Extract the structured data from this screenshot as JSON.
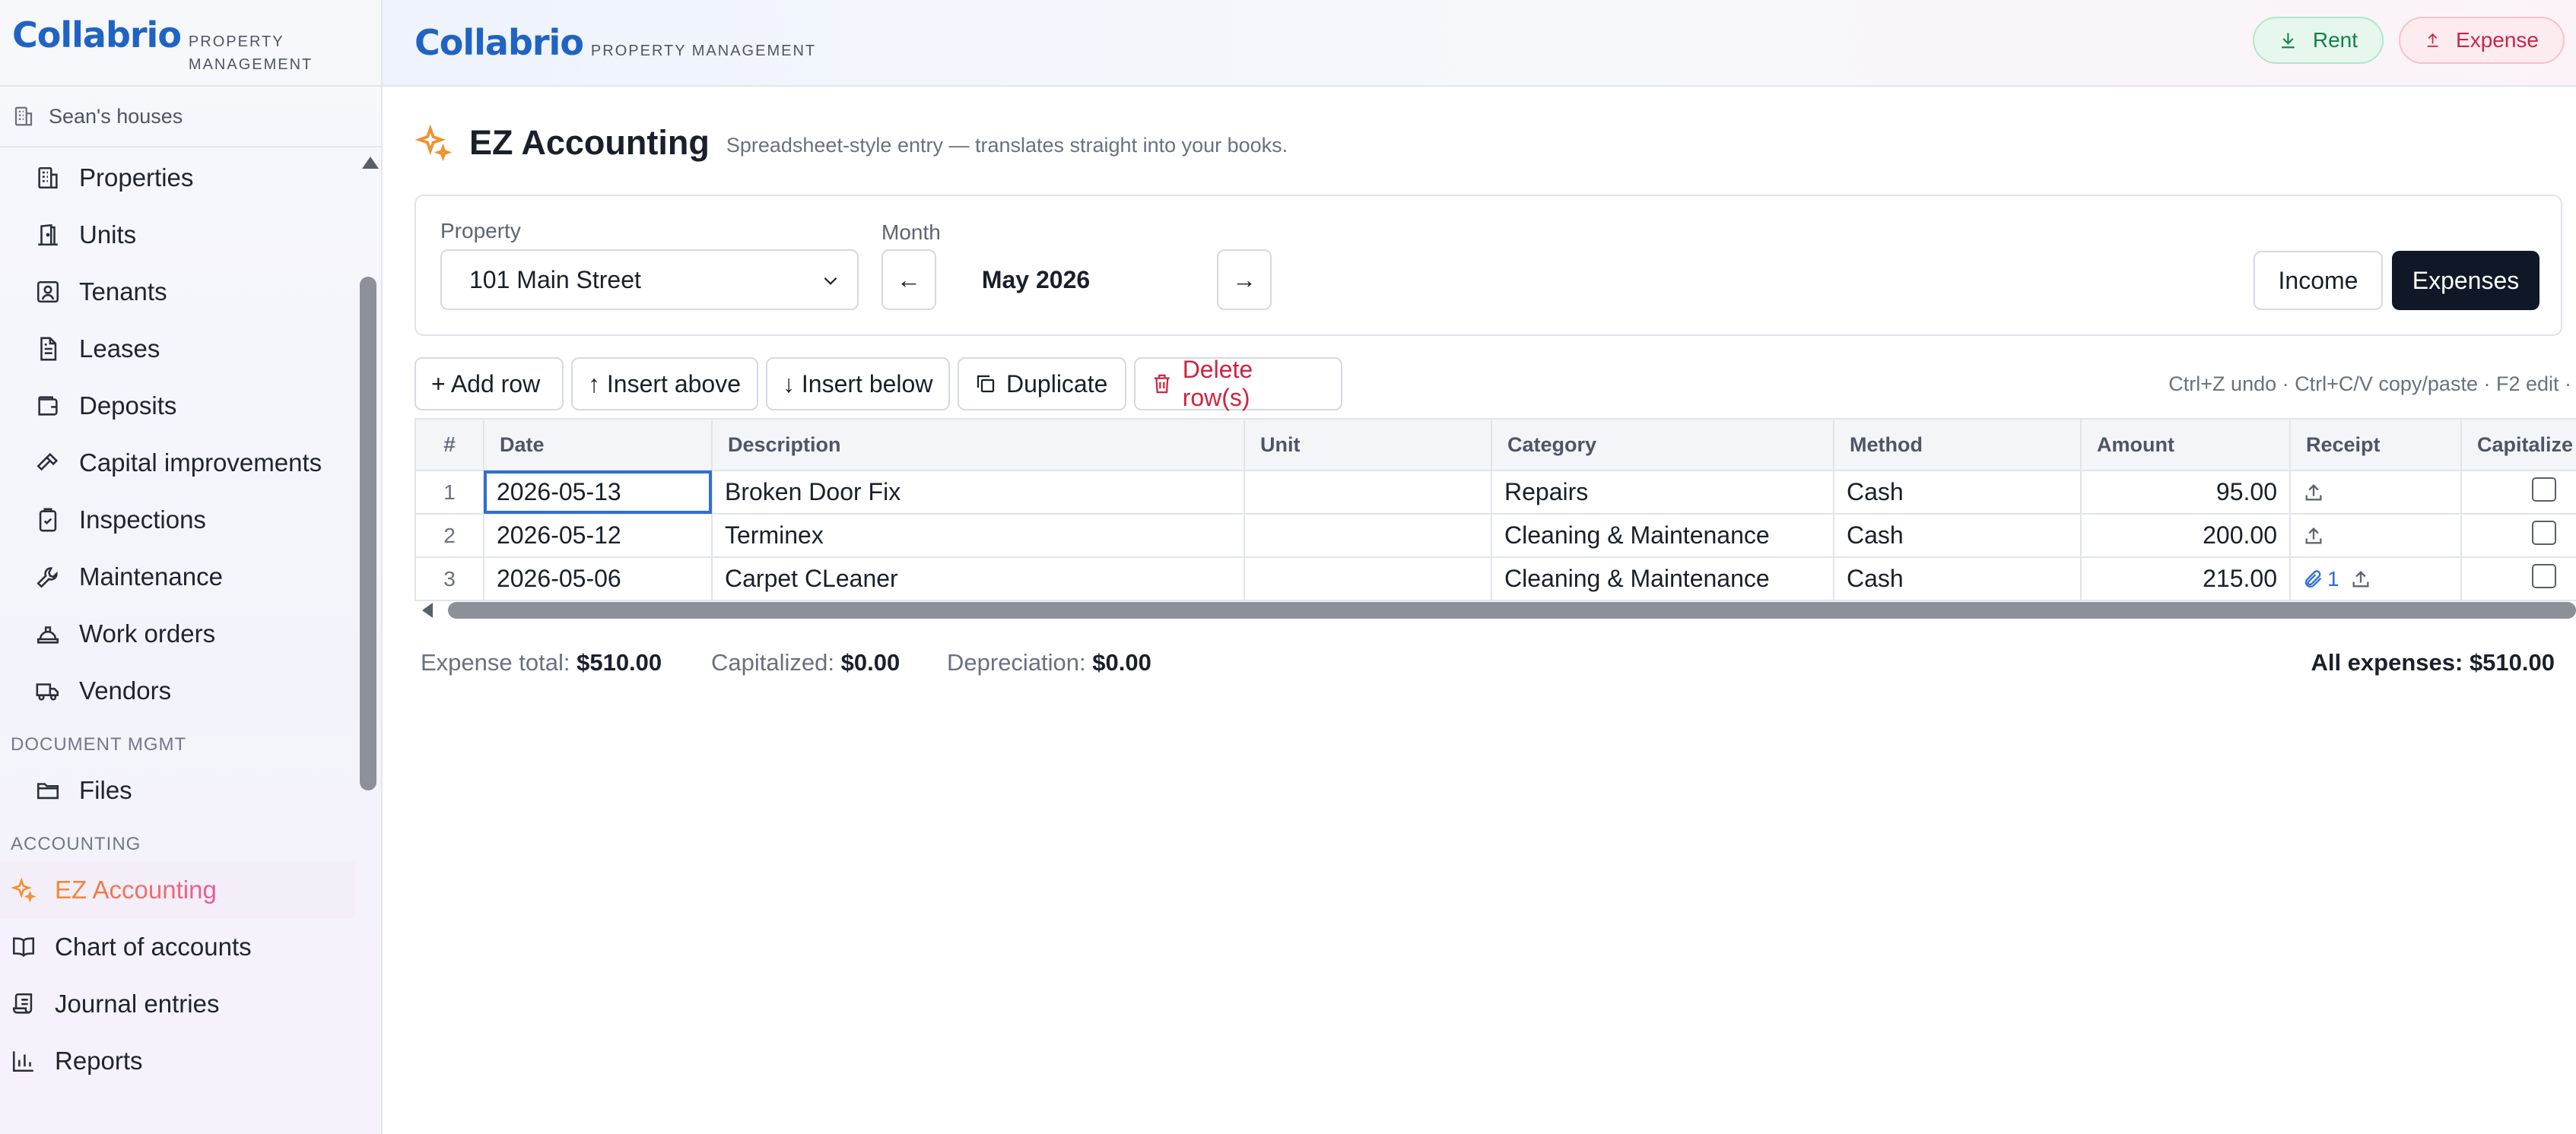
{
  "brand": {
    "name": "Collabrio",
    "tagline_line1": "PROPERTY",
    "tagline_line2": "MANAGEMENT",
    "tagline": "PROPERTY MANAGEMENT"
  },
  "sidebar": {
    "org": "Sean's houses",
    "items": [
      {
        "label": "Properties",
        "icon": "building-icon"
      },
      {
        "label": "Units",
        "icon": "door-icon"
      },
      {
        "label": "Tenants",
        "icon": "contact-icon"
      },
      {
        "label": "Leases",
        "icon": "document-icon"
      },
      {
        "label": "Deposits",
        "icon": "wallet-icon"
      },
      {
        "label": "Capital improvements",
        "icon": "hammer-icon"
      },
      {
        "label": "Inspections",
        "icon": "clipboard-check-icon"
      },
      {
        "label": "Maintenance",
        "icon": "wrench-icon"
      },
      {
        "label": "Work orders",
        "icon": "hardhat-icon"
      },
      {
        "label": "Vendors",
        "icon": "truck-icon"
      }
    ],
    "sections": {
      "document": {
        "label": "DOCUMENT MGMT",
        "items": [
          {
            "label": "Files",
            "icon": "folder-icon"
          }
        ]
      },
      "accounting": {
        "label": "ACCOUNTING",
        "items": [
          {
            "label": "EZ Accounting",
            "icon": "sparkles-icon",
            "active": true
          },
          {
            "label": "Chart of accounts",
            "icon": "book-icon"
          },
          {
            "label": "Journal entries",
            "icon": "scroll-icon"
          },
          {
            "label": "Reports",
            "icon": "bar-chart-icon"
          }
        ]
      }
    }
  },
  "topbar": {
    "rent_label": "Rent",
    "expense_label": "Expense"
  },
  "page": {
    "title": "EZ Accounting",
    "subtitle": "Spreadsheet-style entry — translates straight into your books."
  },
  "filters": {
    "property_label": "Property",
    "property_value": "101 Main Street",
    "month_label": "Month",
    "month_value": "May 2026",
    "prev_label": "←",
    "next_label": "→",
    "income_label": "Income",
    "expenses_label": "Expenses",
    "selected_mode": "Expenses"
  },
  "toolbar": {
    "add_row": "+ Add row",
    "insert_above": "↑ Insert above",
    "insert_below": "↓ Insert below",
    "duplicate": "Duplicate",
    "delete": "Delete row(s)",
    "hint": "Ctrl+Z undo · Ctrl+C/V copy/paste · F2 edit · "
  },
  "grid": {
    "columns": [
      "#",
      "Date",
      "Description",
      "Unit",
      "Category",
      "Method",
      "Amount",
      "Receipt",
      "Capitalize"
    ],
    "rows": [
      {
        "num": "1",
        "date": "2026-05-13",
        "description": "Broken Door Fix",
        "unit": "",
        "category": "Repairs",
        "method": "Cash",
        "amount": "95.00",
        "receipt_count": "",
        "capitalize": false
      },
      {
        "num": "2",
        "date": "2026-05-12",
        "description": "Terminex",
        "unit": "",
        "category": "Cleaning & Maintenance",
        "method": "Cash",
        "amount": "200.00",
        "receipt_count": "",
        "capitalize": false
      },
      {
        "num": "3",
        "date": "2026-05-06",
        "description": "Carpet CLeaner",
        "unit": "",
        "category": "Cleaning & Maintenance",
        "method": "Cash",
        "amount": "215.00",
        "receipt_count": "1",
        "capitalize": false
      }
    ]
  },
  "totals": {
    "expense_label": "Expense total:",
    "expense_value": "$510.00",
    "capitalized_label": "Capitalized:",
    "capitalized_value": "$0.00",
    "depreciation_label": "Depreciation:",
    "depreciation_value": "$0.00",
    "all_label": "All expenses:",
    "all_value": "$510.00"
  },
  "colors": {
    "brand": "#1f63c4",
    "accent_active": "#f0922e",
    "dark_button": "#101827",
    "danger": "#d0233f",
    "rent": "#15804a",
    "expense": "#c9254a"
  }
}
